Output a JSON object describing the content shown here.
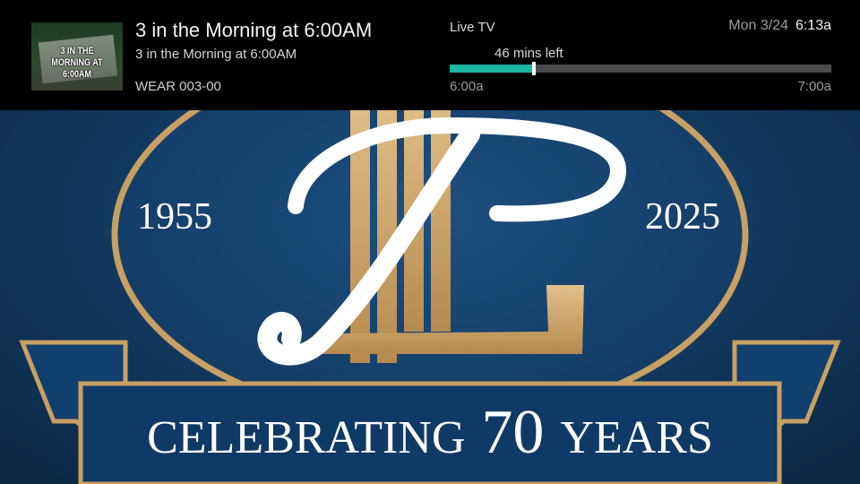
{
  "info_bar": {
    "thumbnail_text": [
      "3 IN THE",
      "MORNING AT 6:00AM"
    ],
    "title": "3 in the Morning at 6:00AM",
    "subtitle": "3 in the Morning at 6:00AM",
    "channel": "WEAR 003-00",
    "live_label": "Live TV",
    "date": "Mon 3/24",
    "time": "6:13a",
    "mins_left": "46 mins left",
    "start_time": "6:00a",
    "end_time": "7:00a",
    "progress_fraction": 0.22,
    "progress_color": "#1bb6a0"
  },
  "background": {
    "year_left": "1955",
    "year_right": "2025",
    "banner_word_1": "CELEBRATING",
    "banner_number": "70",
    "banner_word_2": "YEARS",
    "colors": {
      "navy": "#0f3356",
      "gold": "#c9a064",
      "cream": "#ffffff"
    }
  }
}
